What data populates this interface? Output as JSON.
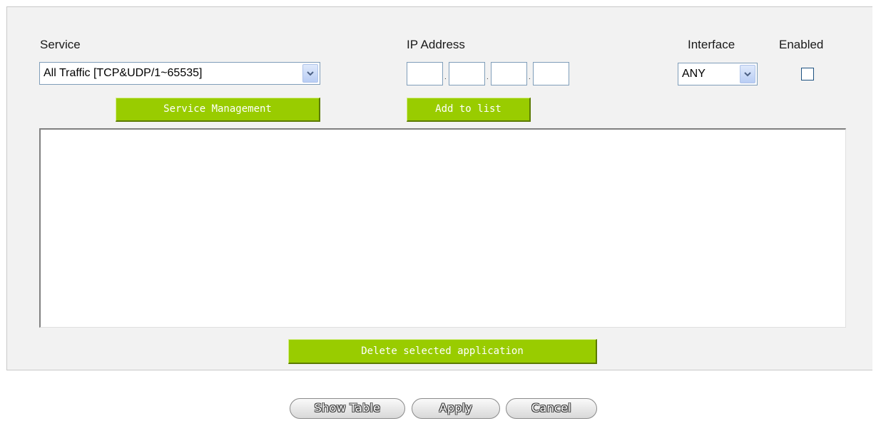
{
  "form": {
    "service_label": "Service",
    "service_selected": "All Traffic [TCP&UDP/1~65535]",
    "ip_label": "IP Address",
    "ip_octets": [
      "",
      "",
      "",
      ""
    ],
    "interface_label": "Interface",
    "interface_selected": "ANY",
    "enabled_label": "Enabled",
    "enabled_checked": false,
    "service_management_label": "Service Management",
    "add_to_list_label": "Add to list",
    "delete_selected_label": "Delete selected application"
  },
  "footer": {
    "show_table_label": "Show Table",
    "apply_label": "Apply",
    "cancel_label": "Cancel"
  },
  "colors": {
    "green_button": "#99cc00",
    "panel_background": "#f2f2f2"
  },
  "icons": {
    "dropdown": "chevron-down-icon"
  }
}
